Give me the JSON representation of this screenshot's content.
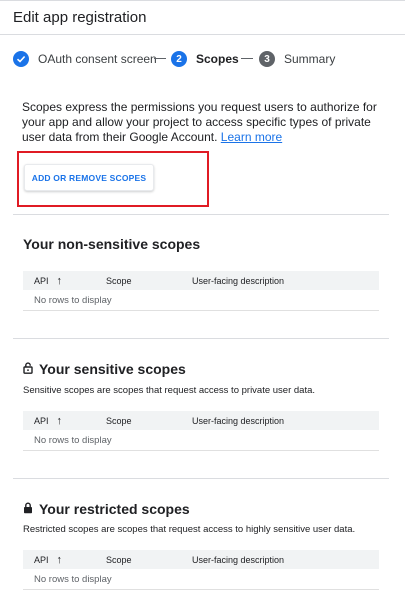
{
  "header": {
    "title": "Edit app registration"
  },
  "stepper": {
    "steps": [
      {
        "number": "1",
        "label": "OAuth consent screen",
        "state": "done"
      },
      {
        "number": "2",
        "label": "Scopes",
        "state": "active"
      },
      {
        "number": "3",
        "label": "Summary",
        "state": "todo"
      }
    ]
  },
  "intro": {
    "text": "Scopes express the permissions you request users to authorize for your app and allow your project to access specific types of private user data from their Google Account.",
    "link": "Learn more"
  },
  "actions": {
    "add_remove_scopes": "ADD OR REMOVE SCOPES"
  },
  "columns": {
    "api": "API",
    "scope": "Scope",
    "description": "User-facing description"
  },
  "sections": {
    "non_sensitive": {
      "title": "Your non-sensitive scopes",
      "empty": "No rows to display"
    },
    "sensitive": {
      "title": "Your sensitive scopes",
      "description": "Sensitive scopes are scopes that request access to private user data.",
      "empty": "No rows to display"
    },
    "restricted": {
      "title": "Your restricted scopes",
      "description": "Restricted scopes are scopes that request access to highly sensitive user data.",
      "empty": "No rows to display"
    }
  },
  "icons": {
    "step_done": "check-icon",
    "sensitive": "lock-open-icon",
    "restricted": "lock-icon",
    "sort": "arrow-up-icon"
  },
  "colors": {
    "accent": "#1a73e8",
    "highlight": "#e01b24",
    "step_todo": "#5f6368"
  }
}
